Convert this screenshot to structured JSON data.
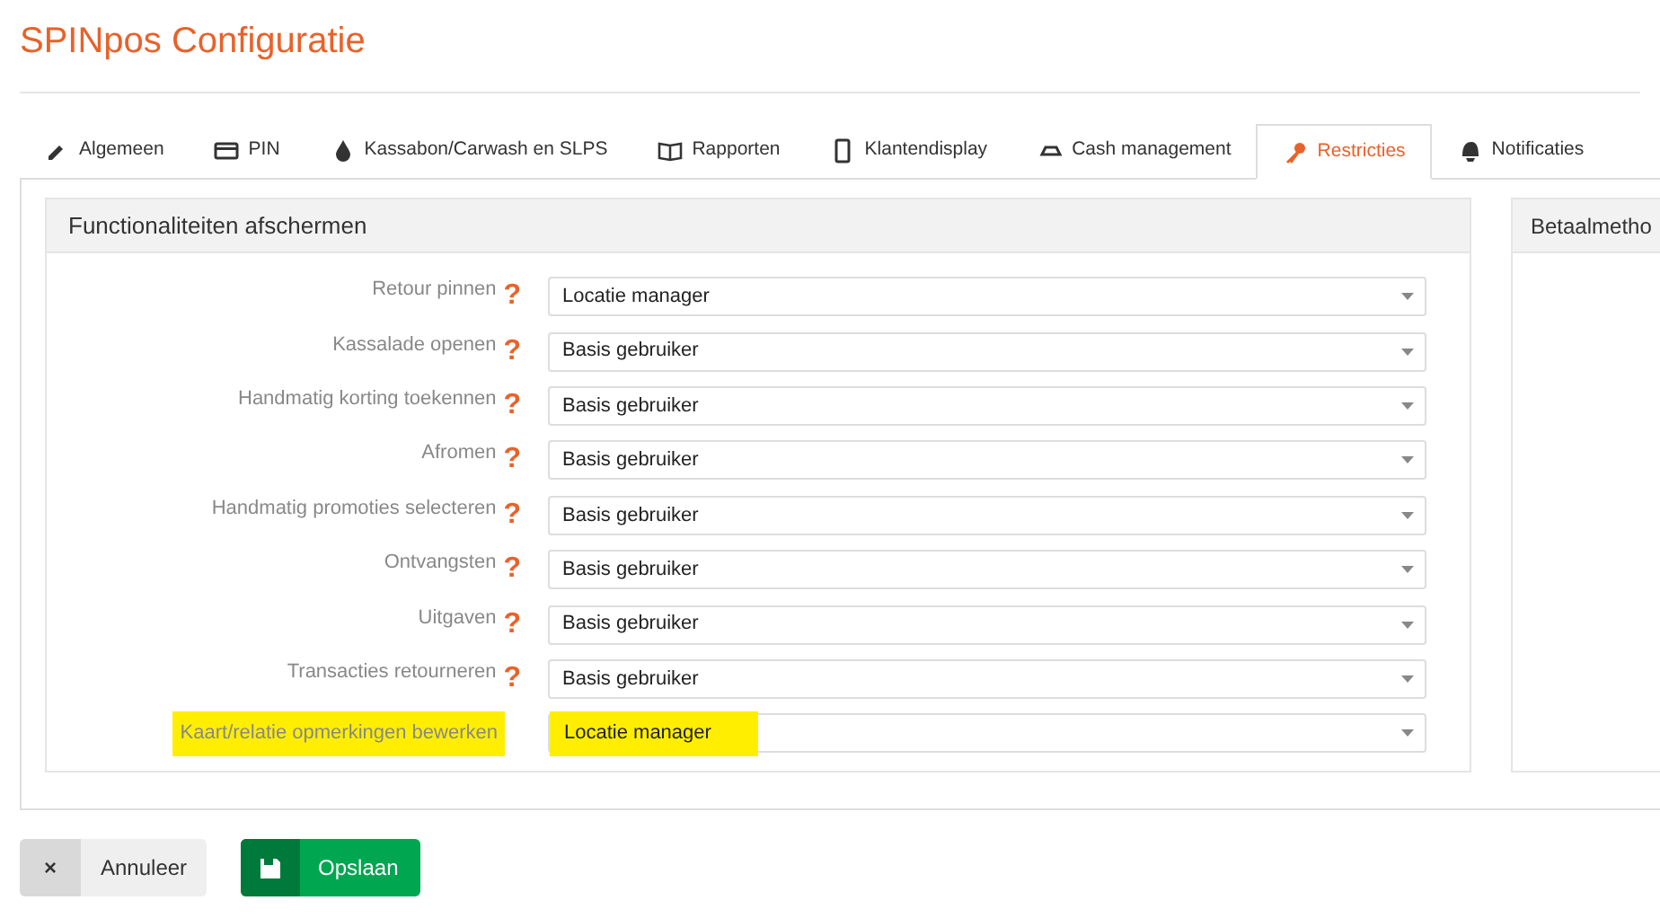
{
  "page_title": "SPINpos Configuratie",
  "tabs": [
    {
      "label": "Algemeen",
      "kind": "pencil",
      "selected": false
    },
    {
      "label": "PIN",
      "kind": "card",
      "selected": false
    },
    {
      "label": "Kassabon/Carwash en SLPS",
      "kind": "drop",
      "selected": false
    },
    {
      "label": "Rapporten",
      "kind": "book",
      "selected": false
    },
    {
      "label": "Klantendisplay",
      "kind": "phone",
      "selected": false
    },
    {
      "label": "Cash management",
      "kind": "cash",
      "selected": false
    },
    {
      "label": "Restricties",
      "kind": "key",
      "selected": true
    },
    {
      "label": "Notificaties",
      "kind": "bell",
      "selected": false
    }
  ],
  "panel": {
    "title": "Functionaliteiten afschermen",
    "rows": [
      {
        "label": "Retour pinnen",
        "hint": "?",
        "value": "Locatie manager",
        "highlighted": false
      },
      {
        "label": "Kassalade openen",
        "hint": "?",
        "value": "Basis gebruiker",
        "highlighted": false
      },
      {
        "label": "Handmatig korting toekennen",
        "hint": "?",
        "value": "Basis gebruiker",
        "highlighted": false
      },
      {
        "label": "Afromen",
        "hint": "?",
        "value": "Basis gebruiker",
        "highlighted": false
      },
      {
        "label": "Handmatig promoties selecteren",
        "hint": "?",
        "value": "Basis gebruiker",
        "highlighted": false
      },
      {
        "label": "Ontvangsten",
        "hint": "?",
        "value": "Basis gebruiker",
        "highlighted": false
      },
      {
        "label": "Uitgaven",
        "hint": "?",
        "value": "Basis gebruiker",
        "highlighted": false
      },
      {
        "label": "Transacties retourneren",
        "hint": "?",
        "value": "Basis gebruiker",
        "highlighted": false
      },
      {
        "label": "Kaart/relatie opmerkingen bewerken",
        "value": "Locatie manager",
        "highlighted": true
      }
    ]
  },
  "side_panel": {
    "title": "Betaalmetho"
  },
  "buttons": [
    {
      "kind": "cancel",
      "icon": "×",
      "label": "Annuleer"
    },
    {
      "kind": "save",
      "label": "Opslaan"
    }
  ]
}
